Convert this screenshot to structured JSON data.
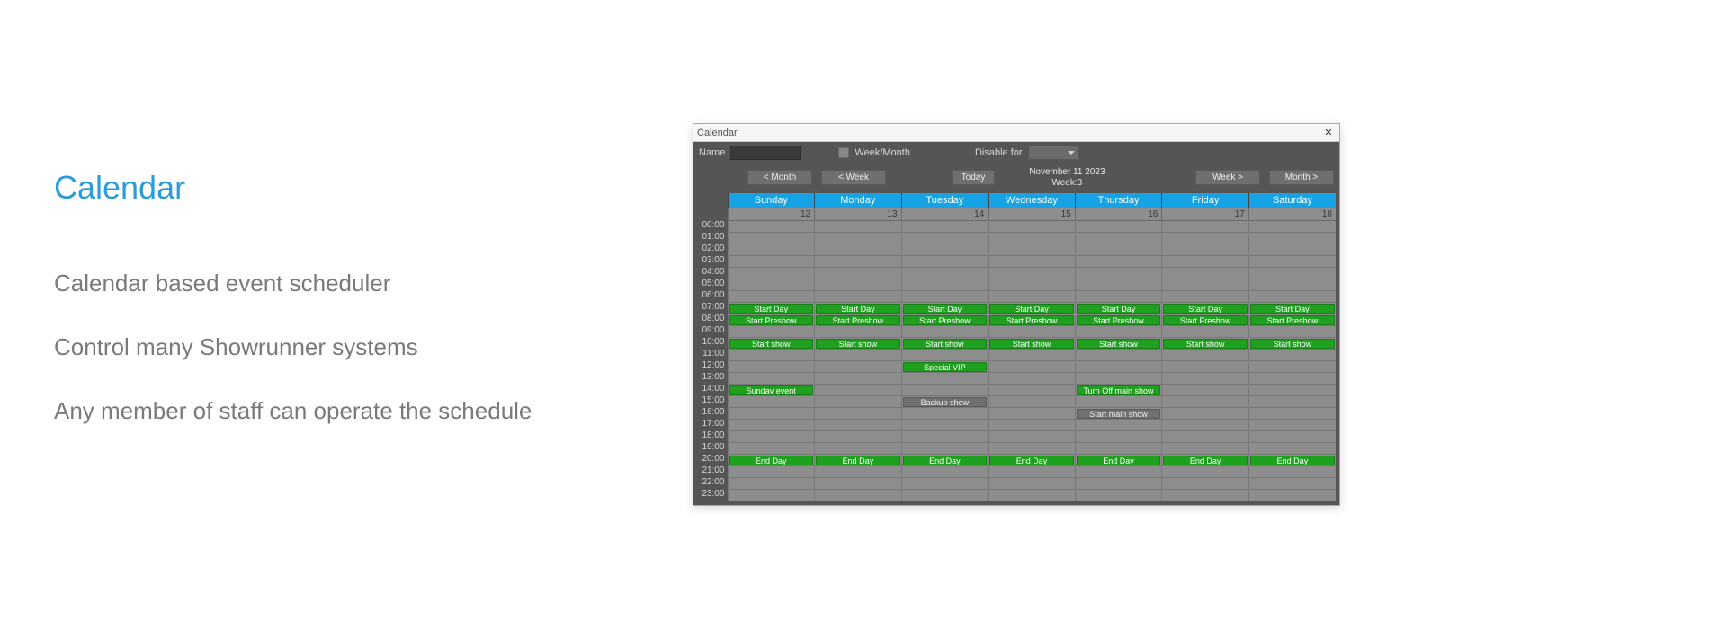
{
  "marketing": {
    "title": "Calendar",
    "bullets": [
      "Calendar based event scheduler",
      "Control many Showrunner systems",
      "Any member of staff can operate the schedule"
    ]
  },
  "window": {
    "title": "Calendar",
    "close_glyph": "✕"
  },
  "toolbar": {
    "name_label": "Name",
    "week_month_label": "Week/Month",
    "disable_for_label": "Disable for"
  },
  "nav": {
    "prev_month": "< Month",
    "prev_week": "< Week",
    "today": "Today",
    "date_line1": "November 11 2023",
    "date_line2": "Week:3",
    "next_week": "Week >",
    "next_month": "Month >"
  },
  "calendar": {
    "days": [
      "Sunday",
      "Monday",
      "Tuesday",
      "Wednesday",
      "Thursday",
      "Friday",
      "Saturday"
    ],
    "dates": [
      "12",
      "13",
      "14",
      "15",
      "16",
      "17",
      "18"
    ],
    "hours": [
      "00:00",
      "01:00",
      "02:00",
      "03:00",
      "04:00",
      "05:00",
      "06:00",
      "07:00",
      "08:00",
      "09:00",
      "10:00",
      "11:00",
      "12:00",
      "13:00",
      "14:00",
      "15:00",
      "16:00",
      "17:00",
      "18:00",
      "19:00",
      "20:00",
      "21:00",
      "22:00",
      "23:00"
    ],
    "events": [
      {
        "hour": 7,
        "day": 0,
        "label": "Start Day",
        "color": "green"
      },
      {
        "hour": 7,
        "day": 1,
        "label": "Start Day",
        "color": "green"
      },
      {
        "hour": 7,
        "day": 2,
        "label": "Start Day",
        "color": "green"
      },
      {
        "hour": 7,
        "day": 3,
        "label": "Start Day",
        "color": "green"
      },
      {
        "hour": 7,
        "day": 4,
        "label": "Start Day",
        "color": "green"
      },
      {
        "hour": 7,
        "day": 5,
        "label": "Start Day",
        "color": "green"
      },
      {
        "hour": 7,
        "day": 6,
        "label": "Start Day",
        "color": "green"
      },
      {
        "hour": 8,
        "day": 0,
        "label": "Start Preshow",
        "color": "green"
      },
      {
        "hour": 8,
        "day": 1,
        "label": "Start Preshow",
        "color": "green"
      },
      {
        "hour": 8,
        "day": 2,
        "label": "Start Preshow",
        "color": "green"
      },
      {
        "hour": 8,
        "day": 3,
        "label": "Start Preshow",
        "color": "green"
      },
      {
        "hour": 8,
        "day": 4,
        "label": "Start Preshow",
        "color": "green"
      },
      {
        "hour": 8,
        "day": 5,
        "label": "Start Preshow",
        "color": "green"
      },
      {
        "hour": 8,
        "day": 6,
        "label": "Start Preshow",
        "color": "green"
      },
      {
        "hour": 10,
        "day": 0,
        "label": "Start show",
        "color": "green"
      },
      {
        "hour": 10,
        "day": 1,
        "label": "Start show",
        "color": "green"
      },
      {
        "hour": 10,
        "day": 2,
        "label": "Start show",
        "color": "green"
      },
      {
        "hour": 10,
        "day": 3,
        "label": "Start show",
        "color": "green"
      },
      {
        "hour": 10,
        "day": 4,
        "label": "Start show",
        "color": "green"
      },
      {
        "hour": 10,
        "day": 5,
        "label": "Start show",
        "color": "green"
      },
      {
        "hour": 10,
        "day": 6,
        "label": "Start show",
        "color": "green"
      },
      {
        "hour": 12,
        "day": 2,
        "label": "Special VIP",
        "color": "green"
      },
      {
        "hour": 14,
        "day": 0,
        "label": "Sunday event",
        "color": "green"
      },
      {
        "hour": 14,
        "day": 4,
        "label": "Turn Off main show",
        "color": "green"
      },
      {
        "hour": 15,
        "day": 2,
        "label": "Backup show",
        "color": "gray"
      },
      {
        "hour": 16,
        "day": 4,
        "label": "Start main show",
        "color": "gray"
      },
      {
        "hour": 20,
        "day": 0,
        "label": "End Day",
        "color": "green"
      },
      {
        "hour": 20,
        "day": 1,
        "label": "End Day",
        "color": "green"
      },
      {
        "hour": 20,
        "day": 2,
        "label": "End Day",
        "color": "green"
      },
      {
        "hour": 20,
        "day": 3,
        "label": "End Day",
        "color": "green"
      },
      {
        "hour": 20,
        "day": 4,
        "label": "End Day",
        "color": "green"
      },
      {
        "hour": 20,
        "day": 5,
        "label": "End Day",
        "color": "green"
      },
      {
        "hour": 20,
        "day": 6,
        "label": "End Day",
        "color": "green"
      }
    ]
  }
}
